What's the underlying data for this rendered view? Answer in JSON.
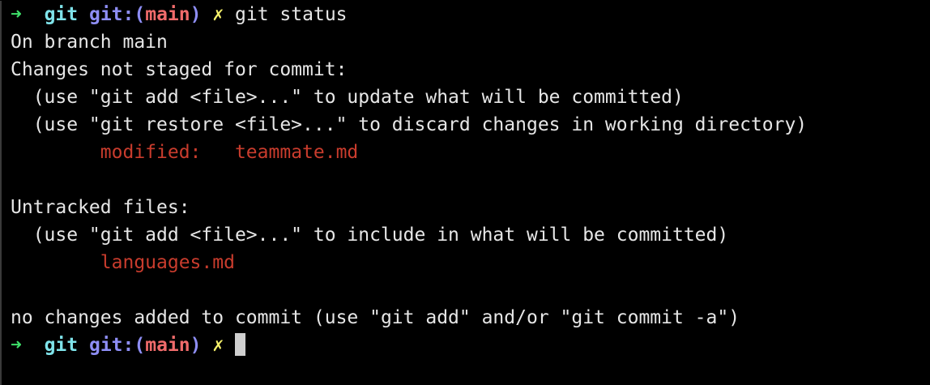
{
  "prompt": {
    "arrow": "➜",
    "dir": "git",
    "branch_prefix": "git:(",
    "branch_name": "main",
    "branch_suffix": ")",
    "dirty_mark": "✗"
  },
  "command": "git status",
  "output": {
    "line1": "On branch main",
    "line2": "Changes not staged for commit:",
    "line3": "  (use \"git add <file>...\" to update what will be committed)",
    "line4": "  (use \"git restore <file>...\" to discard changes in working directory)",
    "modified_label": "modified:",
    "modified_file": "teammate.md",
    "line7": "Untracked files:",
    "line8": "  (use \"git add <file>...\" to include in what will be committed)",
    "untracked_file": "languages.md",
    "line11": "no changes added to commit (use \"git add\" and/or \"git commit -a\")"
  },
  "colors": {
    "background": "#000000",
    "foreground": "#e6e6e6",
    "arrow": "#3ee06a",
    "dir": "#7fe3ea",
    "branch_prefix": "#8e8ef5",
    "branch_name": "#f06b6b",
    "dirty": "#f6f16a",
    "red_output": "#c93c2d"
  }
}
